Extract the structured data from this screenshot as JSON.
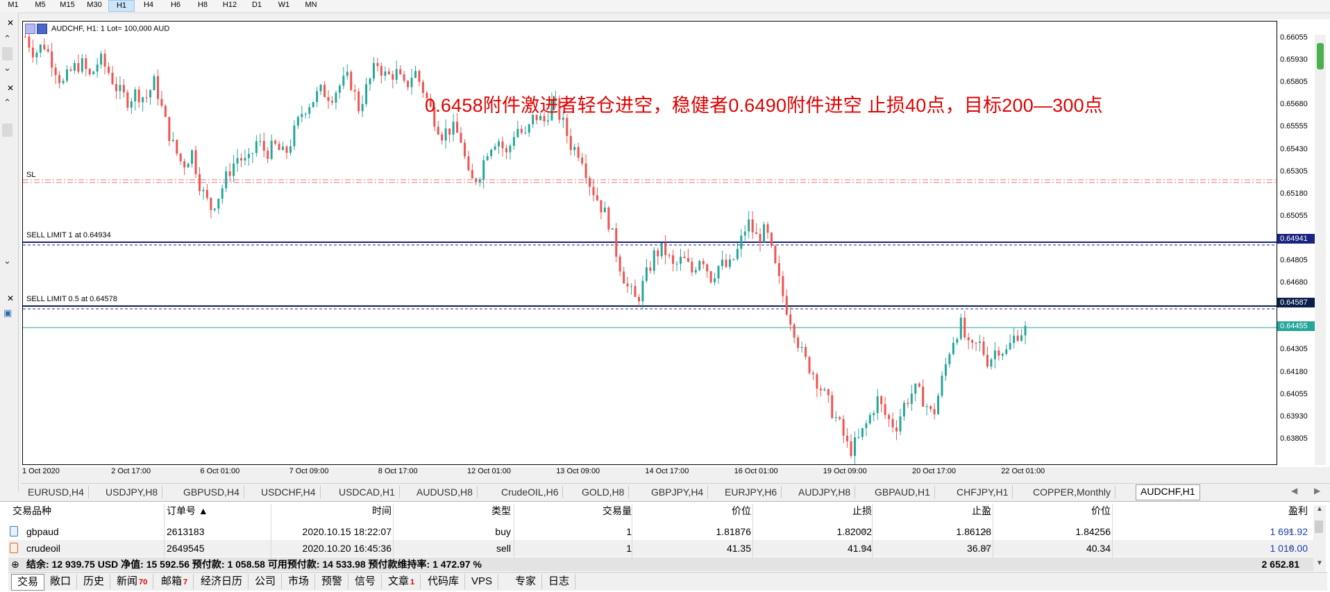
{
  "timeframes": [
    "M1",
    "M5",
    "M15",
    "M30",
    "H1",
    "H4",
    "H6",
    "H8",
    "H12",
    "D1",
    "W1",
    "MN"
  ],
  "active_timeframe": "H1",
  "chart": {
    "header": "AUDCHF, H1:  1 Lot= 100,000 AUD",
    "note": "0.6458附件激进者轻仓进空，稳健者0.6490附件进空  止损40点，目标200—300点",
    "sl_label": "SL",
    "sell_limit_1": "SELL LIMIT 1 at 0.64934",
    "sell_limit_2": "SELL LIMIT 0.5 at 0.64578",
    "price_axis": [
      "0.66055",
      "0.65930",
      "0.65805",
      "0.65680",
      "0.65555",
      "0.65430",
      "0.65305",
      "0.65180",
      "0.65055",
      "0.64930",
      "0.64805",
      "0.64680",
      "0.64555",
      "0.64430",
      "0.64305",
      "0.64180",
      "0.64055",
      "0.63930",
      "0.63805"
    ],
    "tag_sell1": "0.64941",
    "tag_sell2": "0.64587",
    "tag_bid": "0.64455",
    "date_axis": [
      "1 Oct 2020",
      "2 Oct 17:00",
      "6 Oct 01:00",
      "7 Oct 09:00",
      "8 Oct 17:00",
      "12 Oct 01:00",
      "13 Oct 09:00",
      "14 Oct 17:00",
      "16 Oct 01:00",
      "19 Oct 09:00",
      "20 Oct 17:00",
      "22 Oct 01:00"
    ],
    "colors": {
      "up": "#26a69a",
      "down": "#ef5350",
      "sl_line": "#e57373",
      "sell_line": "#1a237e",
      "bid_line": "#26a69a",
      "note": "#e00000"
    }
  },
  "chart_data": {
    "type": "candlestick",
    "symbol": "AUDCHF",
    "timeframe": "H1",
    "x_range": [
      "1 Oct 2020",
      "22 Oct 2020"
    ],
    "ylim": [
      0.6375,
      0.6612
    ],
    "close_path": [
      [
        0,
        0.6604
      ],
      [
        2,
        0.6595
      ],
      [
        4,
        0.66
      ],
      [
        6,
        0.659
      ],
      [
        8,
        0.6578
      ],
      [
        10,
        0.6586
      ],
      [
        12,
        0.659
      ],
      [
        14,
        0.6582
      ],
      [
        16,
        0.6592
      ],
      [
        18,
        0.6585
      ],
      [
        20,
        0.6575
      ],
      [
        22,
        0.657
      ],
      [
        24,
        0.6574
      ],
      [
        26,
        0.6571
      ],
      [
        28,
        0.658
      ],
      [
        30,
        0.656
      ],
      [
        32,
        0.6545
      ],
      [
        34,
        0.6535
      ],
      [
        36,
        0.6542
      ],
      [
        38,
        0.6522
      ],
      [
        40,
        0.6512
      ],
      [
        42,
        0.652
      ],
      [
        44,
        0.6532
      ],
      [
        46,
        0.654
      ],
      [
        48,
        0.6535
      ],
      [
        50,
        0.6548
      ],
      [
        52,
        0.6542
      ],
      [
        54,
        0.6545
      ],
      [
        56,
        0.654
      ],
      [
        58,
        0.6552
      ],
      [
        60,
        0.6565
      ],
      [
        62,
        0.657
      ],
      [
        64,
        0.6575
      ],
      [
        66,
        0.6572
      ],
      [
        68,
        0.6578
      ],
      [
        70,
        0.6582
      ],
      [
        72,
        0.6566
      ],
      [
        74,
        0.6578
      ],
      [
        76,
        0.659
      ],
      [
        78,
        0.6582
      ],
      [
        80,
        0.6585
      ],
      [
        82,
        0.6576
      ],
      [
        84,
        0.6586
      ],
      [
        86,
        0.6575
      ],
      [
        88,
        0.6562
      ],
      [
        90,
        0.6552
      ],
      [
        92,
        0.6555
      ],
      [
        94,
        0.655
      ],
      [
        96,
        0.6525
      ],
      [
        98,
        0.653
      ],
      [
        100,
        0.6545
      ],
      [
        102,
        0.655
      ],
      [
        104,
        0.654
      ],
      [
        106,
        0.6556
      ],
      [
        108,
        0.655
      ],
      [
        110,
        0.6562
      ],
      [
        112,
        0.6558
      ],
      [
        114,
        0.657
      ],
      [
        116,
        0.6558
      ],
      [
        118,
        0.6545
      ],
      [
        120,
        0.6542
      ],
      [
        122,
        0.6525
      ],
      [
        124,
        0.6515
      ],
      [
        126,
        0.6505
      ],
      [
        128,
        0.6485
      ],
      [
        130,
        0.647
      ],
      [
        132,
        0.6462
      ],
      [
        134,
        0.6475
      ],
      [
        136,
        0.6488
      ],
      [
        138,
        0.649
      ],
      [
        140,
        0.648
      ],
      [
        142,
        0.6485
      ],
      [
        144,
        0.6478
      ],
      [
        146,
        0.6488
      ],
      [
        148,
        0.6475
      ],
      [
        150,
        0.6482
      ],
      [
        152,
        0.648
      ],
      [
        154,
        0.649
      ],
      [
        156,
        0.6505
      ],
      [
        158,
        0.6496
      ],
      [
        160,
        0.65
      ],
      [
        162,
        0.648
      ],
      [
        164,
        0.6462
      ],
      [
        166,
        0.6448
      ],
      [
        168,
        0.6432
      ],
      [
        170,
        0.6425
      ],
      [
        172,
        0.6415
      ],
      [
        174,
        0.6405
      ],
      [
        176,
        0.6395
      ],
      [
        178,
        0.6382
      ],
      [
        180,
        0.6388
      ],
      [
        182,
        0.6398
      ],
      [
        184,
        0.641
      ],
      [
        186,
        0.64
      ],
      [
        188,
        0.6395
      ],
      [
        190,
        0.6408
      ],
      [
        192,
        0.6415
      ],
      [
        194,
        0.641
      ],
      [
        196,
        0.64
      ],
      [
        198,
        0.642
      ],
      [
        200,
        0.644
      ],
      [
        202,
        0.645
      ],
      [
        204,
        0.6435
      ],
      [
        206,
        0.644
      ],
      [
        208,
        0.643
      ],
      [
        210,
        0.6438
      ],
      [
        212,
        0.6435
      ],
      [
        214,
        0.6445
      ],
      [
        216,
        0.6447
      ]
    ],
    "series_note": "Approximate hourly close path estimated from the chart"
  },
  "symbol_tabs": [
    "EURUSD,H4",
    "USDJPY,H8",
    "GBPUSD,H4",
    "USDCHF,H4",
    "USDCAD,H1",
    "AUDUSD,H8",
    "CrudeOIL,H6",
    "GOLD,H8",
    "GBPJPY,H4",
    "EURJPY,H6",
    "AUDJPY,H8",
    "GBPAUD,H1",
    "CHFJPY,H1",
    "COPPER,Monthly",
    "AUDCHF,H1"
  ],
  "active_symbol_tab": "AUDCHF,H1",
  "terminal": {
    "headers": [
      "交易品种",
      "订单号 ▲",
      "时间",
      "类型",
      "交易量",
      "价位",
      "止损",
      "止盈",
      "价位",
      "盈利"
    ],
    "rows": [
      [
        "gbpaud",
        "2613183",
        "2020.10.15 18:22:07",
        "buy",
        "1",
        "1.81876",
        "1.82002",
        "1.86128",
        "1.84256",
        "1 691.92"
      ],
      [
        "crudeoil",
        "2649545",
        "2020.10.20 16:45:36",
        "sell",
        "1",
        "41.35",
        "41.94",
        "36.87",
        "40.34",
        "1 010.00"
      ]
    ],
    "summary": "结余: 12 939.75 USD  净值: 15 592.56  预付款: 1 058.58  可用预付款: 14 533.98  预付款维持率: 1 472.97 %",
    "summary_total": "2 652.81",
    "close_mark": "×"
  },
  "bottom_tabs": [
    {
      "label": "交易",
      "badge": ""
    },
    {
      "label": "敞口",
      "badge": ""
    },
    {
      "label": "历史",
      "badge": ""
    },
    {
      "label": "新闻",
      "badge": "70"
    },
    {
      "label": "邮箱",
      "badge": "7"
    },
    {
      "label": "经济日历",
      "badge": ""
    },
    {
      "label": "公司",
      "badge": ""
    },
    {
      "label": "市场",
      "badge": ""
    },
    {
      "label": "预警",
      "badge": ""
    },
    {
      "label": "信号",
      "badge": ""
    },
    {
      "label": "文章",
      "badge": "1"
    },
    {
      "label": "代码库",
      "badge": ""
    },
    {
      "label": "VPS",
      "badge": ""
    },
    {
      "label": "专家",
      "badge": ""
    },
    {
      "label": "日志",
      "badge": ""
    }
  ],
  "active_bottom_tab": "交易"
}
